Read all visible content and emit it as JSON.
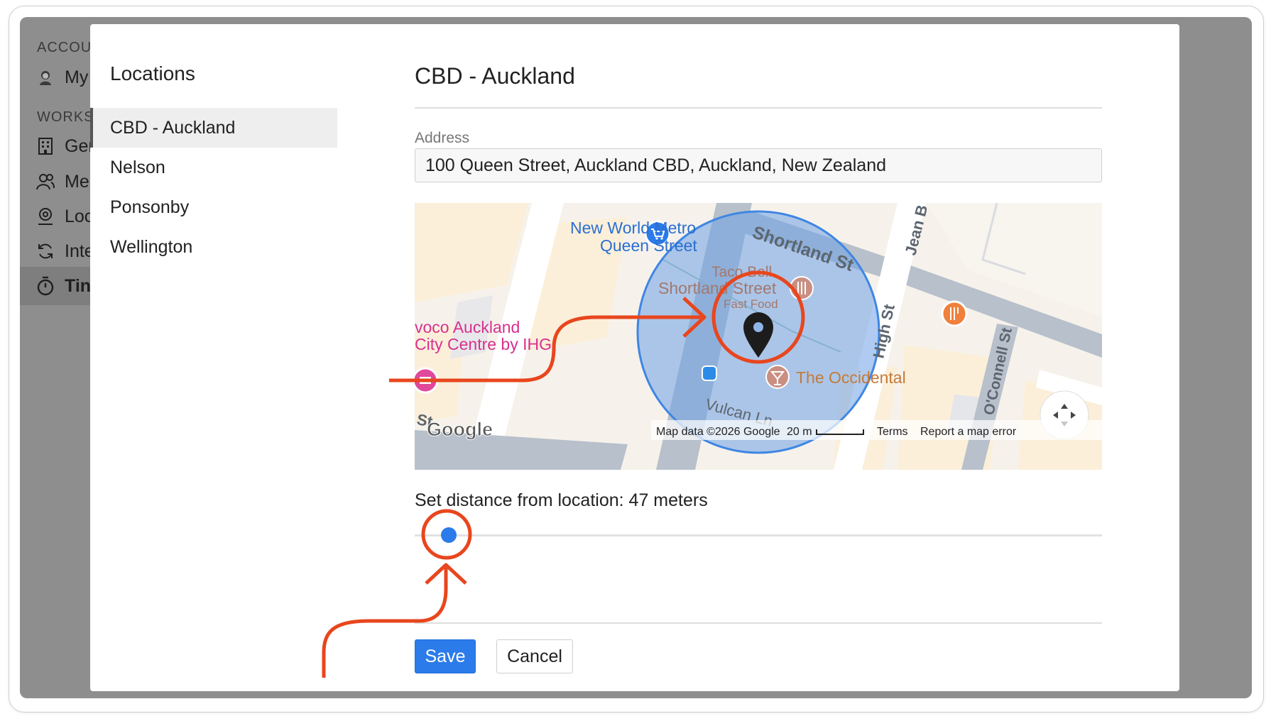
{
  "background_sidebar": {
    "section_account": "ACCOU",
    "section_workspace": "WORKS",
    "items": [
      {
        "label": "My",
        "icon": "avatar-icon"
      },
      {
        "label": "Ger",
        "icon": "building-icon"
      },
      {
        "label": "Me",
        "icon": "members-icon"
      },
      {
        "label": "Loc",
        "icon": "location-icon"
      },
      {
        "label": "Inte",
        "icon": "sync-icon"
      },
      {
        "label": "Tin",
        "icon": "stopwatch-icon",
        "active": true
      }
    ]
  },
  "locations": {
    "title": "Locations",
    "items": [
      {
        "label": "CBD - Auckland",
        "selected": true
      },
      {
        "label": "Nelson"
      },
      {
        "label": "Ponsonby"
      },
      {
        "label": "Wellington"
      }
    ]
  },
  "detail": {
    "title": "CBD - Auckland",
    "address_label": "Address",
    "address_value": "100 Queen Street, Auckland CBD, Auckland, New Zealand",
    "distance_label": "Set distance from location: 47 meters",
    "slider_fraction": 0.05,
    "save_label": "Save",
    "cancel_label": "Cancel"
  },
  "map": {
    "place_new_world_1": "New World Metro",
    "place_new_world_2": "Queen Street",
    "street_shortland": "Shortland St",
    "street_jean": "Jean B",
    "place_taco_1": "Taco Bell",
    "place_taco_2": "Shortland Street",
    "place_taco_3": "Fast Food",
    "place_voco_1": "voco Auckland",
    "place_voco_2": "City Centre by IHG",
    "street_high": "High St",
    "place_occidental": "The Occidental",
    "street_vulcan": "Vulcan Ln",
    "street_oconnell": "O'Connell St",
    "street_st": "St",
    "google_logo": "Google",
    "map_data": "Map data ©2026 Google",
    "scale": "20 m",
    "terms": "Terms",
    "report": "Report a map error"
  },
  "colors": {
    "accent": "#2b7bea",
    "annotation": "#e8461e",
    "radius_fill": "#9fc3ef"
  }
}
